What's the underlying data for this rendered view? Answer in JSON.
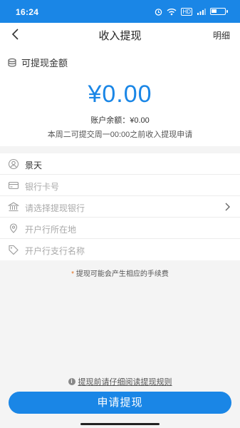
{
  "status": {
    "time": "16:24",
    "network": "HD"
  },
  "nav": {
    "title": "收入提现",
    "detail": "明细"
  },
  "hero": {
    "label": "可提现金额",
    "amount": "¥0.00",
    "balance": "账户余额：¥0.00",
    "notice": "本周二可提交周一00:00之前收入提现申请"
  },
  "form": {
    "name_value": "景天",
    "card_placeholder": "银行卡号",
    "bank_placeholder": "请选择提现银行",
    "location_placeholder": "开户行所在地",
    "branch_placeholder": "开户行支行名称"
  },
  "fee_note": {
    "star": "*",
    "text": "提现可能会产生相应的手续费"
  },
  "rules": {
    "info": "i",
    "text": "提现前请仔细阅读提现规则"
  },
  "submit_label": "申请提现",
  "colors": {
    "accent": "#1a86e6"
  }
}
